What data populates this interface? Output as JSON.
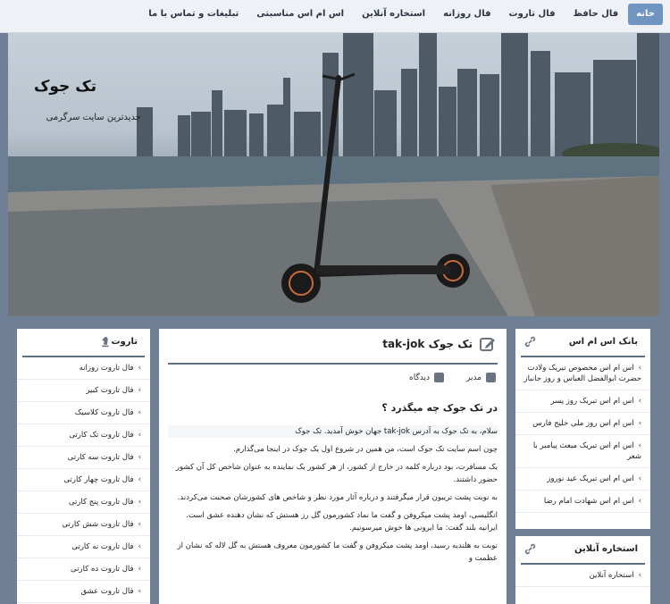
{
  "nav": {
    "items": [
      {
        "label": "خانه",
        "active": true
      },
      {
        "label": "فال حافظ"
      },
      {
        "label": "فال تاروت"
      },
      {
        "label": "فال روزانه"
      },
      {
        "label": "استخاره آنلاین"
      },
      {
        "label": "اس ام اس مناسبتی"
      },
      {
        "label": "تبلیغات و تماس با ما"
      }
    ]
  },
  "hero": {
    "title": "تک جوک",
    "subtitle": "جدیدترین سایت سرگرمی"
  },
  "right_col": {
    "sms_bank": {
      "title": "بانک اس ام اس",
      "items": [
        "اس ام اس مخصوص تبریک ولادت حضرت ابوالفضل العباس و روز جانباز",
        "اس ام اس تبریک روز پسر",
        "اس ام اس روز ملی خلیج فارس",
        "اس ام اس تبریک مبعث پیامبر با شعر",
        "اس ام اس تبریک عید نوروز",
        "اس ام اس شهادت امام رضا"
      ]
    },
    "istikhara": {
      "title": "استخاره آنلاین",
      "items": [
        "استخاره آنلاین"
      ]
    }
  },
  "mid_col": {
    "title": "تک جوک tak-jok",
    "author": "مدیر",
    "views": "دیدگاه",
    "heading": "در تک جوک چه میگذرد ؟",
    "paragraphs": [
      "سلام، به تک جوک به آدرس tak-jok جهان خوش آمدید. تک جوک",
      "چون اسم سایت تک جوک است، من همین در شروع اول یک جوک در اینجا می‌گذارم.",
      "یک مسافرت، بود درباره کلمه در خارج از کشور، از هر کشور یک نماینده به عنوان شاخص کل آن کشور حضور داشتند.",
      "به نوبت پشت تریبون قرار میگرفتند و درباره آثار مورد نظر و شاخص های کشورشان صحبت می‌کردند.",
      "انگلیسی، اومد پشت میکروفن و گفت ما نماد کشورمون گل رز هستش که نشان دهنده عشق است. ایرانیه بلند گفت: ما ایرونی ها خوش میرسونیم.",
      "نوبت به هلندیه رسید، اومد پشت میکروفن و گفت ما کشورمون معروف هستش به گل لاله که نشان از عظمت و"
    ]
  },
  "left_col": {
    "title": "تاروت",
    "items": [
      "فال تاروت روزانه",
      "فال تاروت کبیر",
      "فال تاروت کلاسیک",
      "فال تاروت تک کارتی",
      "فال تاروت سه کارتی",
      "فال تاروت چهار کارتی",
      "فال تاروت پنج کارتی",
      "فال تاروت شش کارتی",
      "فال تاروت نه کارتی",
      "فال تاروت ده کارتی",
      "فال تاروت عشق"
    ]
  }
}
